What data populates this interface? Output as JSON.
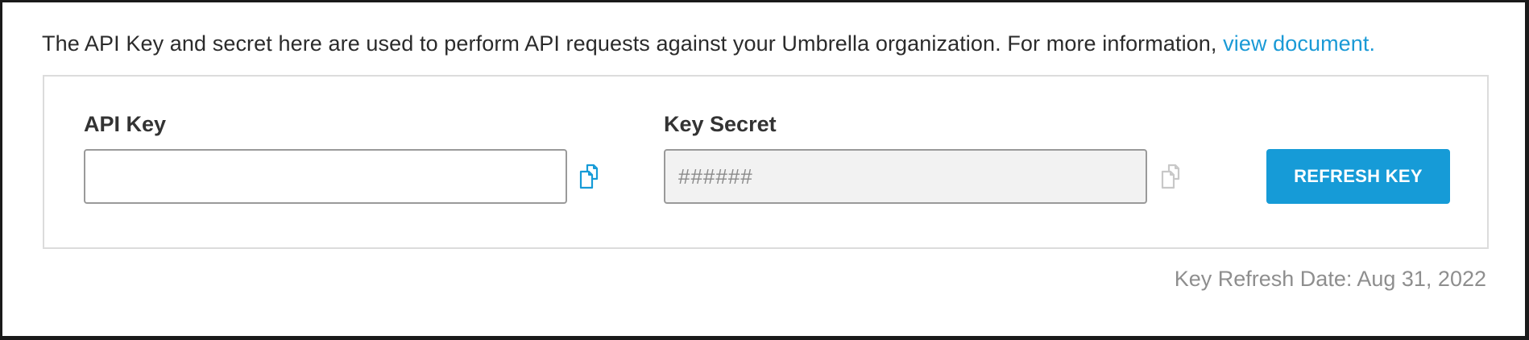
{
  "intro": {
    "text": "The API Key and secret here are used to perform API requests against your Umbrella organization. For more information,",
    "link_label": "view document."
  },
  "api_key": {
    "label": "API Key",
    "value": "",
    "placeholder": ""
  },
  "key_secret": {
    "label": "Key Secret",
    "value": "",
    "placeholder": "######"
  },
  "refresh_button": {
    "label": "REFRESH KEY"
  },
  "refresh_date": {
    "text": "Key Refresh Date: Aug 31, 2022"
  },
  "colors": {
    "accent": "#169bd7",
    "link": "#1a9ad6",
    "muted_text": "#8e8e8e",
    "disabled_bg": "#f2f2f2"
  },
  "icons": {
    "api_key_copy": "copy-icon",
    "key_secret_copy": "copy-icon"
  }
}
